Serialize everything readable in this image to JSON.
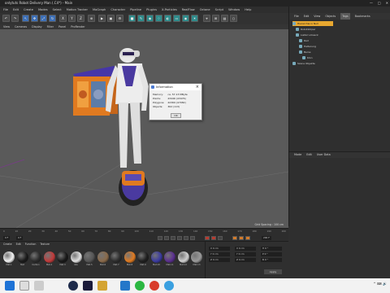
{
  "window": {
    "title": "onlytuts Robot Delivery Man (.C4*) - Main",
    "min": "—",
    "max": "□",
    "close": "✕"
  },
  "menubar": [
    "File",
    "Edit",
    "Create",
    "Modes",
    "Select",
    "Motion Tracker",
    "MoGraph",
    "Character",
    "Pipeline",
    "Plugins",
    "X-Particles",
    "RealFlow",
    "Octane",
    "Script",
    "Window",
    "Help"
  ],
  "viewport_menu": [
    "View",
    "Cameras",
    "Display",
    "Filter",
    "Panel",
    "ProRender"
  ],
  "viewport": {
    "grid_spacing": "Grid Spacing : 100 cm"
  },
  "info_dialog": {
    "title": "Information",
    "close": "×",
    "rows": [
      {
        "label": "Memory:",
        "value": "ca. 57.13 MByte"
      },
      {
        "label": "Points:",
        "value": "43446 (43476)"
      },
      {
        "label": "Polygons:",
        "value": "42369 (47082)"
      },
      {
        "label": "Objects:",
        "value": "362 (113)"
      }
    ],
    "ok": "OK"
  },
  "right_panel": {
    "tabs": [
      "File",
      "Edit",
      "View",
      "Objects",
      "Tags",
      "Bookmarks"
    ],
    "active_tab": "Tags",
    "objects": [
      {
        "name": "Hierarchie in Null",
        "selected": true
      },
      {
        "name": "Robotkörper",
        "selected": false
      },
      {
        "name": "Lieferrucksack",
        "selected": false
      },
      {
        "name": "Rad",
        "selected": false
      },
      {
        "name": "Halterung",
        "selected": false
      },
      {
        "name": "Beine",
        "selected": false
      },
      {
        "name": "Klon",
        "selected": false
      },
      {
        "name": "Szene Objekte",
        "selected": false
      }
    ],
    "attr_tabs": [
      "Mode",
      "Edit",
      "User Data"
    ]
  },
  "timeline": {
    "ticks": [
      "0",
      "10",
      "20",
      "30",
      "40",
      "50",
      "60",
      "70",
      "80",
      "90",
      "100",
      "110",
      "120",
      "130",
      "140",
      "150",
      "160",
      "170",
      "180",
      "190",
      "200"
    ],
    "current_frame": "0 F",
    "start_frame": "0 F",
    "end_frame": "200 F"
  },
  "material_manager": {
    "menu": [
      "Create",
      "Edit",
      "Function",
      "Texture"
    ],
    "materials": [
      {
        "name": "Mat.1",
        "color": "#f2f2f2"
      },
      {
        "name": "Mat",
        "color": "#1a1a1a"
      },
      {
        "name": "Carbon",
        "color": "#2a2a2a"
      },
      {
        "name": "Mat.2",
        "color": "#c23a3a"
      },
      {
        "name": "Mat.3",
        "color": "#181818"
      },
      {
        "name": "Gla",
        "color": "#e0e0e0"
      },
      {
        "name": "Mat.5",
        "color": "#555555"
      },
      {
        "name": "Mat.6",
        "color": "#8a6a4a"
      },
      {
        "name": "Mat.7",
        "color": "#2c2c2c"
      },
      {
        "name": "Mat.8",
        "color": "#e07a20"
      },
      {
        "name": "Mat.9",
        "color": "#1f1f1f"
      },
      {
        "name": "Mat.10",
        "color": "#3a3aa0"
      },
      {
        "name": "Mat.11",
        "color": "#5a2e8f"
      },
      {
        "name": "Mat.12",
        "color": "#d0d0d0"
      },
      {
        "name": "Mat.13",
        "color": "#9a9a9a"
      }
    ]
  },
  "coord_panel": {
    "fields": [
      {
        "label": "X",
        "value": "0 cm"
      },
      {
        "label": "Y",
        "value": "0 cm"
      },
      {
        "label": "Z",
        "value": "0 cm"
      },
      {
        "label": "X",
        "value": "0 cm"
      },
      {
        "label": "Y",
        "value": "0 cm"
      },
      {
        "label": "Z",
        "value": "0 cm"
      },
      {
        "label": "H",
        "value": "0 °"
      },
      {
        "label": "P",
        "value": "0 °"
      },
      {
        "label": "B",
        "value": "0 °"
      }
    ],
    "apply": "Apply"
  },
  "taskbar": {
    "icons": [
      "windows-start",
      "search",
      "task-view",
      "cinema4d",
      "photoshop",
      "explorer",
      "vscode",
      "whatsapp",
      "chrome",
      "app"
    ],
    "tray": "^ ⌨ 🔊"
  },
  "colors": {
    "accent_orange": "#e8a830",
    "robot_body": "#e8e8e8",
    "backpack": "#e07a20",
    "accent_purple": "#4a3aa0"
  }
}
